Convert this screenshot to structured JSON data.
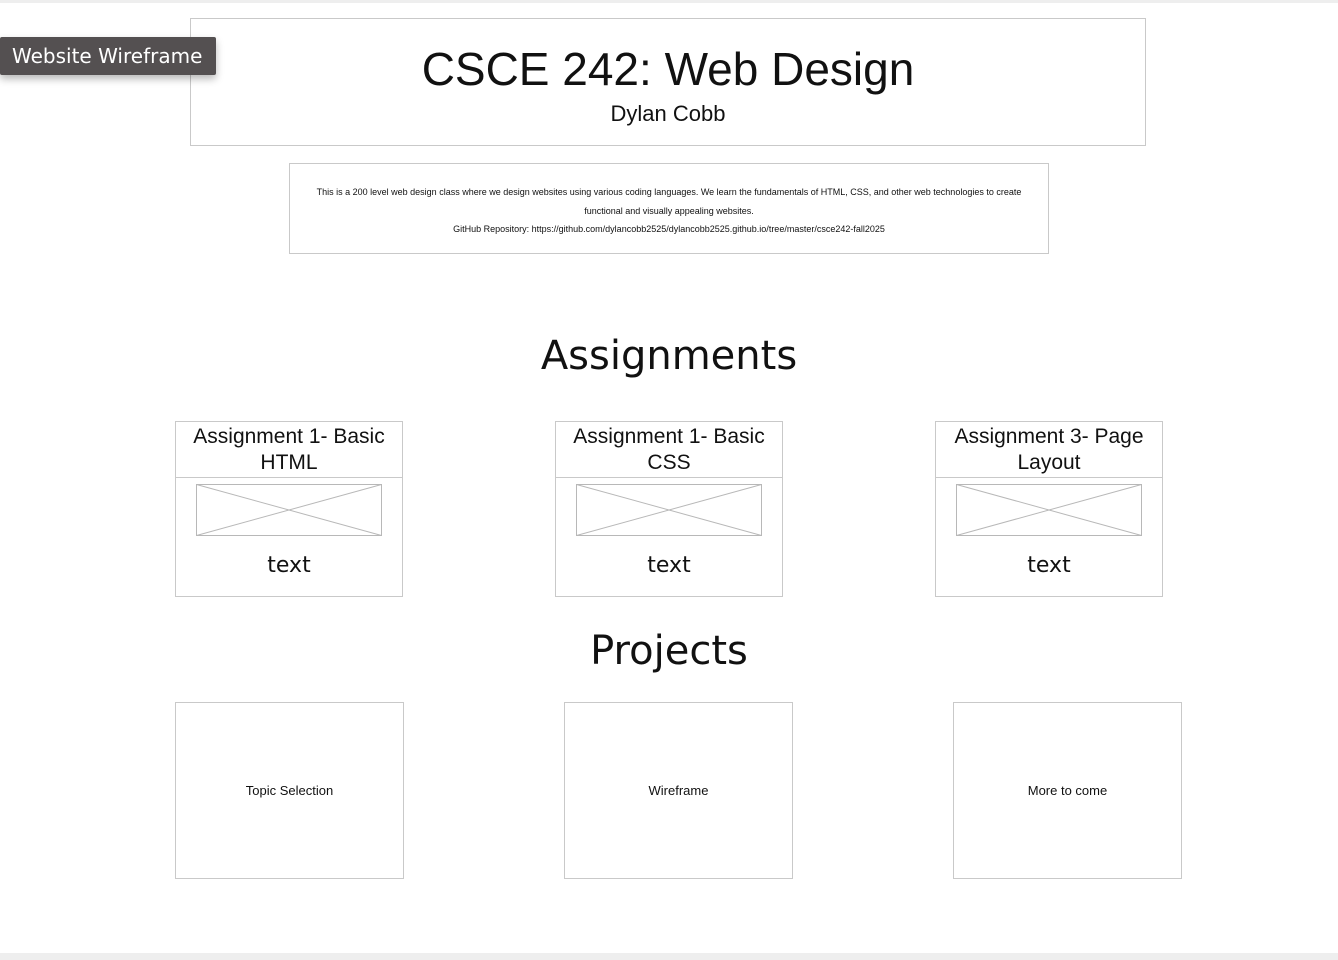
{
  "window": {
    "frame_label": "Website Wireframe"
  },
  "header": {
    "title": "CSCE 242: Web Design",
    "subtitle": "Dylan Cobb"
  },
  "about": {
    "description": "This is a 200 level web design class where we design websites using various coding languages. We learn the fundamentals of HTML, CSS, and other web technologies to create functional and visually appealing websites.",
    "repo": "GitHub Repository: https://github.com/dylancobb2525/dylancobb2525.github.io/tree/master/csce242-fall2025"
  },
  "assignments": {
    "heading": "Assignments",
    "items": [
      {
        "title": "Assignment 1- Basic HTML",
        "text": "text"
      },
      {
        "title": "Assignment 1- Basic CSS",
        "text": "text"
      },
      {
        "title": "Assignment 3- Page Layout",
        "text": "text"
      }
    ]
  },
  "projects": {
    "heading": "Projects",
    "items": [
      {
        "label": "Topic Selection"
      },
      {
        "label": "Wireframe"
      },
      {
        "label": "More to come"
      }
    ]
  },
  "colors": {
    "border": "#c9c9c9",
    "label_bg": "#545051",
    "text": "#111111"
  }
}
